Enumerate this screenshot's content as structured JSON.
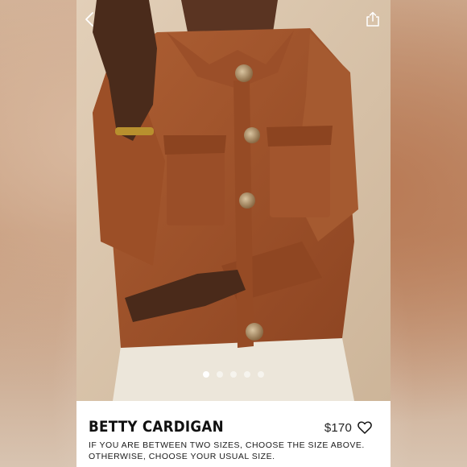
{
  "product": {
    "title": "BETTY CARDIGAN",
    "price": "$170",
    "size_note": "IF YOU ARE BETWEEN TWO SIZES, CHOOSE THE SIZE ABOVE. OTHERWISE, CHOOSE YOUR USUAL SIZE."
  },
  "gallery": {
    "image_count": 5,
    "active_index": 0
  },
  "icons": {
    "back": "chevron-left-icon",
    "share": "share-icon",
    "favorite": "heart-outline-icon"
  },
  "colors": {
    "cardigan": "#a0542b",
    "background": "#d8c3aa",
    "trousers": "#ece6da"
  }
}
